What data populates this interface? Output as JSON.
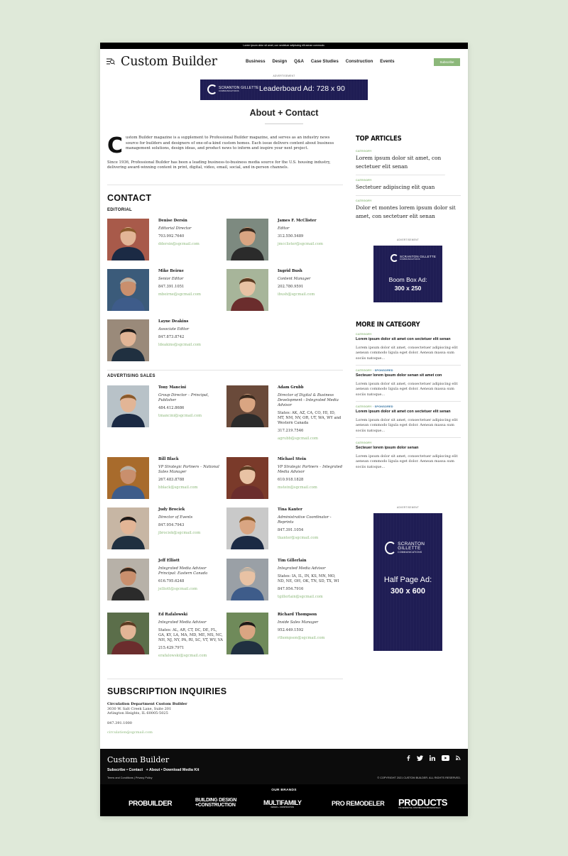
{
  "top_bar": {
    "text": "Lorem ipsum dolor sit amet, con sectetuer adipiscing elit aenan commodo."
  },
  "header": {
    "logo": "Custom Builder",
    "nav": [
      "Business",
      "Design",
      "Q&A",
      "Case Studies",
      "Construction",
      "Events"
    ],
    "subscribe": "Subscribe"
  },
  "ads": {
    "label": "ADVERTISEMENT",
    "brand_name": "SCRANTON GILLETTE",
    "brand_sub": "COMMUNICATIONS",
    "leaderboard": "Leaderboard Ad: 728 x 90",
    "boombox_line1": "Boom Box Ad:",
    "boombox_line2": "300 x 250",
    "halfpage_line1": "Half Page Ad:",
    "halfpage_line2": "300 x 600"
  },
  "page_title": "About + Contact",
  "intro": {
    "dropcap": "C",
    "p1": "ustom Builder magazine is a supplement to Professional Builder magazine, and serves as an industry news source for builders and designers of one-of-a-kind custom homes. Each issue delivers content about business management solutions, design ideas, and product news to inform and inspire your next project.",
    "p2": "Since 1936, Professional Builder has been a leading business-to-business media source for the U.S. housing industry, delivering award-winning content in print, digital, video, email, social, and in-person channels."
  },
  "contact": {
    "heading": "CONTACT",
    "editorial_label": "EDITORIAL",
    "editorial": [
      {
        "name": "Denise Dersin",
        "role": "Editorial Director",
        "phone": "703.992.7640",
        "email": "ddersin@sgcmail.com"
      },
      {
        "name": "James F. McClister",
        "role": "Editor",
        "phone": "312.550.5489",
        "email": "jmcclister@sgcmail.com"
      },
      {
        "name": "Mike Beirne",
        "role": "Senior Editor",
        "phone": "847.391.1051",
        "email": "mbeirne@sgcmail.com"
      },
      {
        "name": "Ingrid Bush",
        "role": "Content Manager",
        "phone": "202.780.9591",
        "email": "ibush@sgcmail.com"
      },
      {
        "name": "Layne Deakins",
        "role": "Associate Editor",
        "phone": "847.873.8742",
        "email": "ldeakins@sgcmail.com"
      }
    ],
    "sales_label": "ADVERTISING SALES",
    "sales": [
      {
        "name": "Tony Mancini",
        "role": "Group Director – Principal, Publisher",
        "phone": "484.412.8686",
        "email": "tmancini@sgcmail.com"
      },
      {
        "name": "Adam Grubb",
        "role": "Director of Digital & Business Development - Integrated Media Advisor",
        "extra": "States: AK, AZ, CA, CO, HI, ID, MT, NM, NV, OR, UT, WA, WY and Western Canada",
        "phone": "317.219.7546",
        "email": "agrubb@sgcmail.com"
      },
      {
        "name": "Bill Black",
        "role": "VP Strategic Partners – National Sales Manager",
        "phone": "267.483.8788",
        "email": "bblack@sgcmail.com"
      },
      {
        "name": "Michael Stein",
        "role": "VP Strategic Partners – Integrated Media Advisor",
        "phone": "610.918.1828",
        "email": "mstein@sgcmail.com"
      },
      {
        "name": "Judy Brociek",
        "role": "Director of Events",
        "phone": "847.954.7943",
        "email": "jbrociek@sgcmail.com"
      },
      {
        "name": "Tina Kanter",
        "role": "Administrative Coordinator - Reprints",
        "phone": "847.391.1054",
        "email": "tkanter@sgcmail.com"
      },
      {
        "name": "Jeff Elliott",
        "role": "Integrated Media Advisor Principal: Eastern Canada",
        "phone": "616.795.6248",
        "email": "jelliott@sgcmail.com"
      },
      {
        "name": "Tim Gillerlain",
        "role": "Integrated Media Advisor",
        "extra": "States: IA, IL, IN, KS, MN, MO, ND, NE, OH, OK, TN, SD, TX, WI",
        "phone": "847.954.7916",
        "email": "tgillerlain@sgcmail.com"
      },
      {
        "name": "Ed Rafalowski",
        "role": "Integrated Media Advisor",
        "extra": "States: AL, AR, CT, DC, DE, FL, GA, KY, LA, MA, MD, ME, MS, NC, NH, NJ, NY, PA, RI, SC, VT, WV, VA",
        "phone": "215.429.7971",
        "email": "erafalowski@sgcmail.com"
      },
      {
        "name": "Richard Thompson",
        "role": "Inside Sales Manager",
        "phone": "952.449.1592",
        "email": "rthompson@sgcmail.com"
      }
    ]
  },
  "subscription": {
    "heading": "SUBSCRIPTION INQUIRIES",
    "dept": "Circulation Department Custom Builder",
    "addr1": "3030 W. Salt Creek Lane, Suite 201",
    "addr2": "Arlington Heights, IL 60005-5025",
    "phone": "847.391.1000",
    "email": "circulation@sgcmail.com"
  },
  "sidebar": {
    "top_heading": "TOP ARTICLES",
    "top_articles": [
      {
        "cat": "CATEGORY",
        "title": "Lorem ipsum dolor sit amet, con sectetuer elit senan"
      },
      {
        "cat": "CATEGORY",
        "title": "Sectetuer adipiscing elit quan"
      },
      {
        "cat": "CATEGORY",
        "title": "Dolor et montes lorem ipsum dolor sit amet, con sectetuer elit senan"
      }
    ],
    "mic_heading": "MORE IN CATEGORY",
    "sponsored": "SPONSORED",
    "more": [
      {
        "cat": "CATEGORY",
        "title": "Lorem ipsum dolor sit amet con sectetuer elit senan",
        "text": "Lorem ipsum dolor sit amet, consectetuer adipiscing elit aenean commodo ligula eget dolor. Aenean massa sum sociis natoque..."
      },
      {
        "cat": "CATEGORY",
        "title": "Secteuer lorem ipsum dolor senan sit amet con",
        "text": "Lorem ipsum dolor sit amet, consectetuer adipiscing elit aenean commodo ligula eget dolor. Aenean massa sum sociis natoque..."
      },
      {
        "cat": "CATEGORY",
        "title": "Lorem ipsum dolor sit amet con sectetuer elit senan",
        "text": "Lorem ipsum dolor sit amet, consectetuer adipiscing elit aenean commodo ligula eget dolor. Aenean massa sum sociis natoque..."
      },
      {
        "cat": "CATEGORY",
        "title": "Secteuer lorem ipsum dolor senan",
        "text": "Lorem ipsum dolor sit amet, consectetuer adipiscing elit aenean commodo ligula eget dolor. Aenean massa sum sociis natoque..."
      }
    ]
  },
  "footer": {
    "logo": "Custom Builder",
    "links": [
      "Subscribe",
      "Contact",
      "+ About",
      "Download Media Kit"
    ],
    "legal": [
      "Terms and Conditions",
      "Privacy Policy"
    ],
    "copyright": "© COPYRIGHT 2021 CUSTOM BUILDER. ALL RIGHTS RESERVED.",
    "social_icons": [
      "facebook-icon",
      "twitter-icon",
      "linkedin-icon",
      "youtube-icon",
      "rss-icon"
    ],
    "brands_heading": "OUR BRANDS",
    "brands": [
      "PROBUILDER",
      "BUILDING DESIGN +CONSTRUCTION",
      "MULTIFAMILY",
      "PRO REMODELER",
      "PRODUCTS"
    ],
    "brand_subs": [
      "DESIGN + CONSTRUCTION",
      "THE RESIDENTIAL CONSTRUCTION PROFESSIONALS"
    ]
  },
  "colors": {
    "accent": "#8cb87a",
    "ad_navy": "#1f1d54",
    "background": "#dfe9d9",
    "footer": "#0c0c0c"
  }
}
